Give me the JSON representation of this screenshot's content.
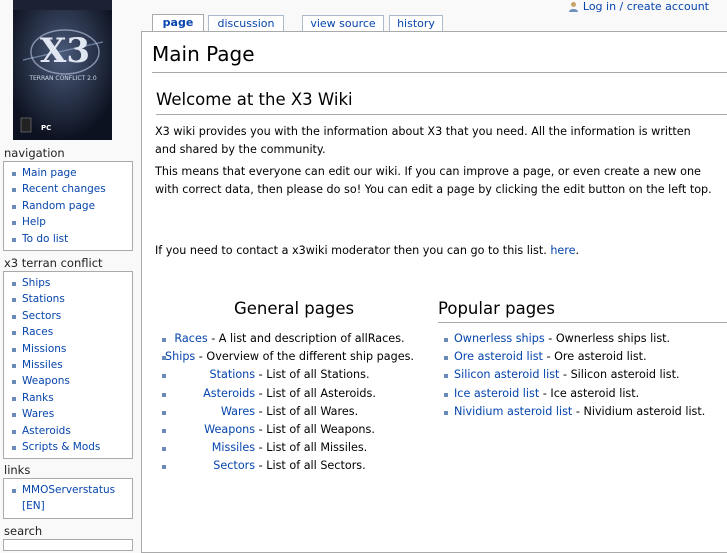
{
  "logo": {
    "title": "X3",
    "subtitle": "TERRAN CONFLICT 2.0",
    "platform": "PC",
    "colors": {
      "bg": "#0d1220",
      "accent": "#9fb4d8"
    }
  },
  "personal": {
    "login_label": "Log in / create account",
    "icon": "user-icon"
  },
  "tabs": [
    {
      "label": "page"
    },
    {
      "label": "discussion"
    },
    {
      "label": "view source"
    },
    {
      "label": "history"
    }
  ],
  "sidebar": {
    "navigation": {
      "title": "navigation",
      "items": [
        "Main page",
        "Recent changes",
        "Random page",
        "Help",
        "To do list"
      ]
    },
    "x3": {
      "title": "x3 terran conflict",
      "items": [
        "Ships",
        "Stations",
        "Sectors",
        "Races",
        "Missions",
        "Missiles",
        "Weapons",
        "Ranks",
        "Wares",
        "Asteroids",
        "Scripts & Mods"
      ]
    },
    "links": {
      "title": "links",
      "items": [
        "MMOServerstatus",
        "[EN]"
      ]
    },
    "search": {
      "title": "search"
    }
  },
  "content": {
    "page_title": "Main Page",
    "welcome": "Welcome at the X3 Wiki",
    "para1": "X3 wiki provides you with the information about X3 that you need. All the information is written and shared by the community.",
    "para2": "This means that everyone can edit our wiki. If you can improve a page, or even create a new one with correct data, then please do so! You can edit a page by clicking the edit button on the left top.",
    "para3_prefix": "If you need to contact a x3wiki moderator then you can go to this list. ",
    "para3_link": "here",
    "para3_suffix": ".",
    "general_title": "General pages",
    "popular_title": "Popular pages",
    "general": [
      {
        "link": "Races",
        "desc": " - A list and description of allRaces."
      },
      {
        "link": "Ships",
        "desc": " - Overview of the different ship pages."
      },
      {
        "link": "Stations",
        "desc": " - List of all Stations."
      },
      {
        "link": "Asteroids",
        "desc": " - List of all Asteroids."
      },
      {
        "link": "Wares",
        "desc": " - List of all Wares."
      },
      {
        "link": "Weapons",
        "desc": " - List of all Weapons."
      },
      {
        "link": "Missiles",
        "desc": " - List of all Missiles."
      },
      {
        "link": "Sectors",
        "desc": " - List of all Sectors."
      }
    ],
    "popular": [
      {
        "link": "Ownerless ships",
        "desc": " - Ownerless ships list."
      },
      {
        "link": "Ore asteroid list",
        "desc": " - Ore asteroid list."
      },
      {
        "link": "Silicon asteroid list",
        "desc": " - Silicon asteroid list."
      },
      {
        "link": "Ice asteroid list",
        "desc": " - Ice asteroid list."
      },
      {
        "link": "Nividium asteroid list",
        "desc": " - Nividium asteroid list."
      }
    ]
  }
}
